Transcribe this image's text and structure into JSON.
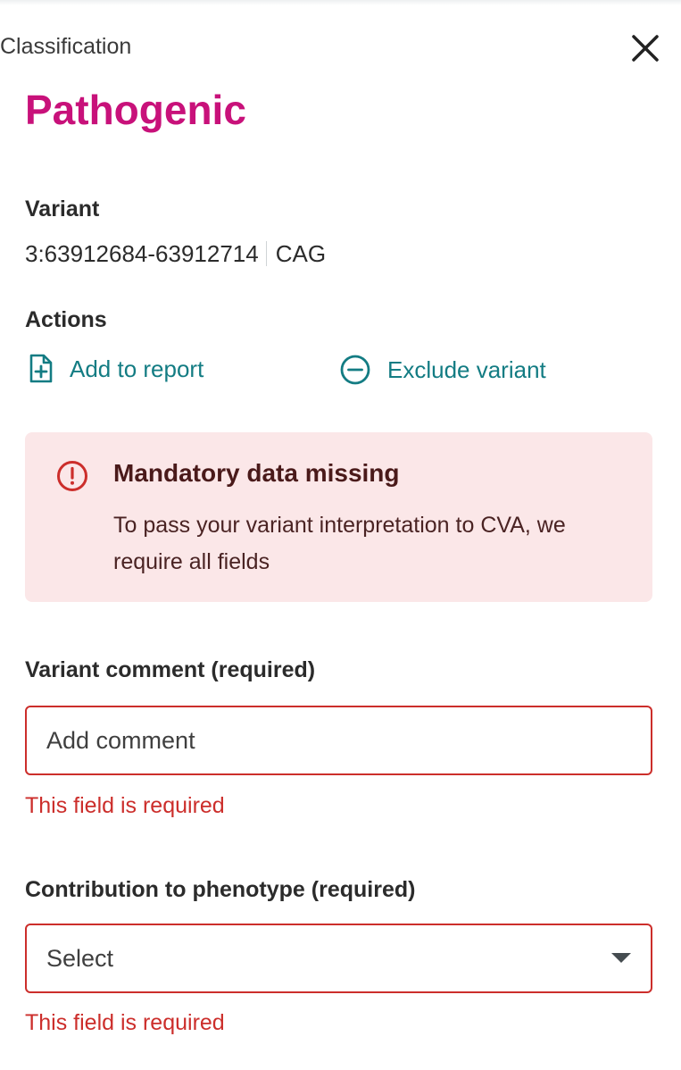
{
  "header": {
    "eyebrow": "Classification",
    "close_icon": "close-icon"
  },
  "classification": {
    "title": "Pathogenic",
    "title_color": "#c8117a"
  },
  "variant": {
    "label": "Variant",
    "position": "3:63912684-63912714",
    "sequence": "CAG"
  },
  "actions": {
    "label": "Actions",
    "add_to_report": {
      "label": "Add to report",
      "icon": "document-plus-icon"
    },
    "exclude_variant": {
      "label": "Exclude variant",
      "icon": "minus-circle-icon"
    },
    "link_color": "#137c83"
  },
  "alert": {
    "icon": "exclamation-circle-icon",
    "title": "Mandatory data missing",
    "body": "To pass your variant interpretation to CVA, we require all fields",
    "background": "#fbe7e8"
  },
  "form": {
    "comment": {
      "label": "Variant comment (required)",
      "placeholder": "Add comment",
      "value": "",
      "error": "This field is required"
    },
    "phenotype": {
      "label": "Contribution to phenotype (required)",
      "selected": "Select",
      "error": "This field is required"
    },
    "error_color": "#cc2e2b"
  }
}
